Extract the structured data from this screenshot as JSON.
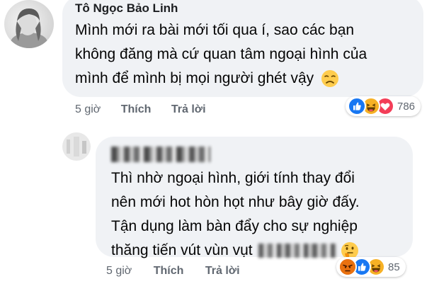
{
  "comment1": {
    "author": "Tô Ngọc Bảo Linh",
    "lines": [
      "Mình mới ra bài mới tối qua í, sao các bạn",
      "không đăng mà cứ quan tâm ngoại hình của",
      "mình để mình bị mọi người ghét vậy"
    ],
    "emoji": "sad-face-icon",
    "time": "5 giờ",
    "like_label": "Thích",
    "reply_label": "Trả lời",
    "reactions": [
      "like-icon",
      "haha-icon",
      "love-icon"
    ],
    "reaction_count": "786"
  },
  "comment2": {
    "lines": [
      "Thì nhờ ngoại hình, giới tính thay đổi",
      "nên mới hot hòn họt như bây giờ đấy.",
      "Tận dụng làm bàn đẩy cho sự nghiệp",
      "thăng tiến vút vùn vụt"
    ],
    "emoji": "thinking-face-icon",
    "time": "5 giờ",
    "like_label": "Thích",
    "reply_label": "Trả lời",
    "reactions": [
      "angry-icon",
      "like-icon",
      "haha-icon"
    ],
    "reaction_count": "85"
  },
  "colors": {
    "bubble": "#f0f2f5",
    "meta_text": "#606770",
    "like_blue": "#1877f2",
    "love_red": "#f33e58",
    "haha_yellow": "#f7b125",
    "angry_orange": "#e9710f"
  }
}
